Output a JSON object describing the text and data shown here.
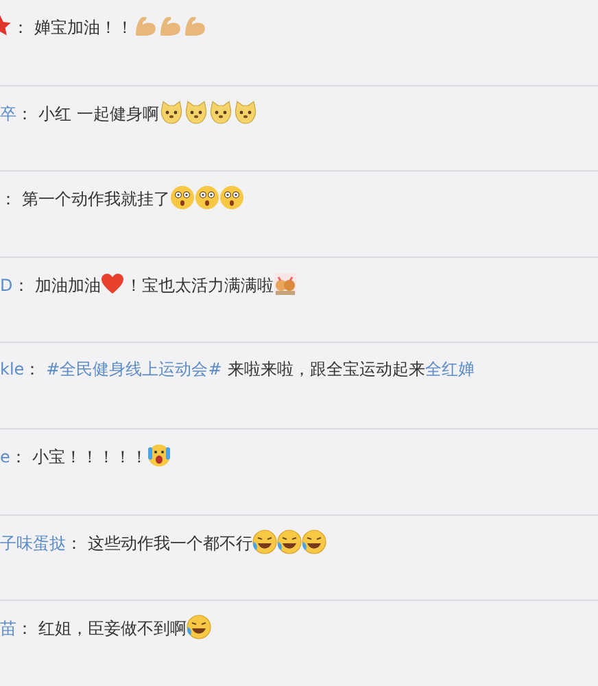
{
  "comments": [
    {
      "user": [
        {
          "kind": "star"
        }
      ],
      "body": [
        {
          "kind": "text",
          "text": "婵宝加油！！"
        },
        {
          "kind": "flex"
        },
        {
          "kind": "flex"
        },
        {
          "kind": "flex"
        }
      ]
    },
    {
      "user": [
        {
          "kind": "text",
          "text": "卒"
        }
      ],
      "body": [
        {
          "kind": "text",
          "text": "小红 一起健身啊"
        },
        {
          "kind": "doge"
        },
        {
          "kind": "doge"
        },
        {
          "kind": "doge"
        },
        {
          "kind": "doge"
        }
      ]
    },
    {
      "body": [
        {
          "kind": "text",
          "text": "第一个动作我就挂了"
        },
        {
          "kind": "shock"
        },
        {
          "kind": "shock"
        },
        {
          "kind": "shock"
        }
      ]
    },
    {
      "user": [
        {
          "kind": "text",
          "text": "D"
        }
      ],
      "body": [
        {
          "kind": "text",
          "text": "加油加油"
        },
        {
          "kind": "heart"
        },
        {
          "kind": "text",
          "text": "！宝也太活力满满啦"
        },
        {
          "kind": "pets"
        }
      ]
    },
    {
      "user": [
        {
          "kind": "text",
          "text": "kle"
        }
      ],
      "body": [
        {
          "kind": "topic",
          "text": "#全民健身线上运动会#"
        },
        {
          "kind": "text",
          "text": "来啦来啦，跟全宝运动起来"
        },
        {
          "kind": "mention",
          "text": "全红婵"
        }
      ]
    },
    {
      "user": [
        {
          "kind": "text",
          "text": "e"
        }
      ],
      "body": [
        {
          "kind": "text",
          "text": "小宝！！！！！"
        },
        {
          "kind": "scream"
        }
      ]
    },
    {
      "user": [
        {
          "kind": "text",
          "text": "子味蛋挞"
        }
      ],
      "body": [
        {
          "kind": "text",
          "text": "这些动作我一个都不行"
        },
        {
          "kind": "laugh"
        },
        {
          "kind": "laugh"
        },
        {
          "kind": "laugh"
        }
      ]
    },
    {
      "user": [
        {
          "kind": "text",
          "text": "苗"
        }
      ],
      "body": [
        {
          "kind": "text",
          "text": "红姐，臣妾做不到啊"
        },
        {
          "kind": "laugh"
        }
      ]
    }
  ],
  "separator": "："
}
